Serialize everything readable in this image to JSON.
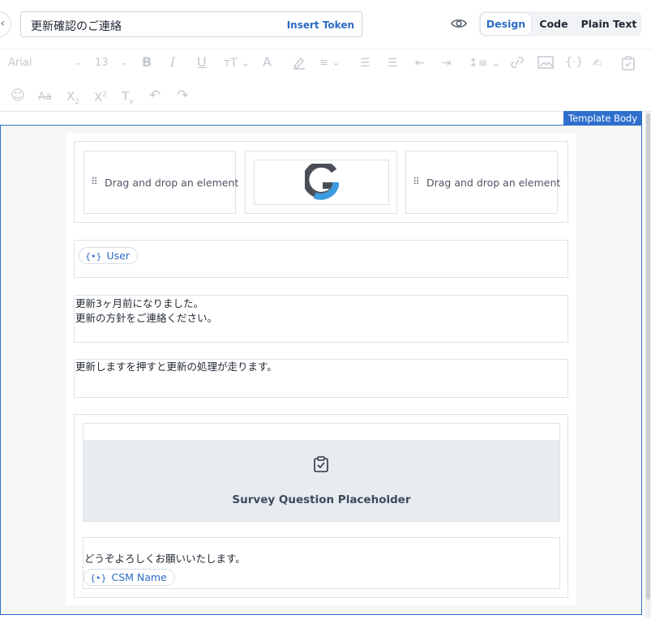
{
  "header": {
    "back_icon": "chevron-left-icon",
    "subject_value": "更新確認のご連絡",
    "insert_token_label": "Insert Token",
    "preview_icon": "eye-icon",
    "modes": [
      "Design",
      "Code",
      "Plain Text"
    ],
    "active_mode": "Design"
  },
  "toolbar": {
    "font_family": "Arial",
    "font_size": "13",
    "row1_icons": [
      "bold-icon",
      "italic-icon",
      "underline-icon",
      "text-size-icon",
      "font-color-icon",
      "highlight-icon",
      "align-icon",
      "bullet-list-icon",
      "numbered-list-icon",
      "outdent-icon",
      "indent-icon",
      "line-height-icon",
      "link-icon",
      "image-icon",
      "token-icon",
      "signature-icon",
      "clipboard-icon"
    ],
    "row2_icons": [
      "emoji-icon",
      "strikethrough-icon",
      "subscript-icon",
      "superscript-icon",
      "clear-format-icon",
      "undo-icon",
      "redo-icon"
    ]
  },
  "canvas": {
    "badge": "Template Body",
    "header_row": {
      "left_placeholder": "Drag and drop an element",
      "right_placeholder": "Drag and drop an element",
      "logo": "google-logo"
    },
    "user_token": "User",
    "paragraph1": [
      "更新3ヶ月前になりました。",
      "更新の方針をご連絡ください。"
    ],
    "paragraph2": "更新しますを押すと更新の処理が走ります。",
    "survey": {
      "icon": "clipboard-check-icon",
      "label": "Survey Question Placeholder"
    },
    "closing": "どうぞよろしくお願いいたします。",
    "csm_token": "CSM Name"
  },
  "colors": {
    "accent": "#2b6cc4",
    "border_active": "#2f6fcd",
    "canvas_bg": "#f6f6f4",
    "survey_bg": "#e8ebf0"
  }
}
